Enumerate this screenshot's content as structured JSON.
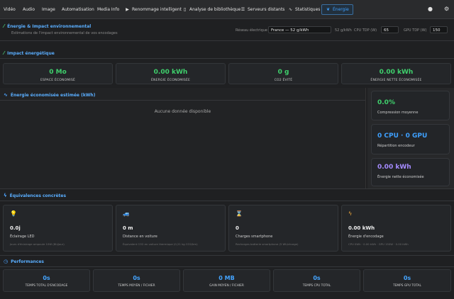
{
  "nav": {
    "items": [
      "Vidéo",
      "Audio",
      "Image",
      "Automatisation",
      "Media Info"
    ],
    "icon_items": [
      {
        "label": "Renommage intelligent",
        "icon": "play-square-icon"
      },
      {
        "label": "Analyse de bibliothèque",
        "icon": "book-icon"
      },
      {
        "label": "Serveurs distants",
        "icon": "server-icon"
      },
      {
        "label": "Statistiques",
        "icon": "chart-line-icon"
      },
      {
        "label": "Énergie",
        "icon": "leaf-icon"
      }
    ],
    "active": "Énergie",
    "right_icons": [
      "user-icon",
      "gear-icon"
    ]
  },
  "header": {
    "title": "Énergie & Impact environnemental",
    "subtitle": "Estimations de l'impact environnemental de vos encodages",
    "grid_label": "Réseau électrique",
    "grid_value": "France — 52 g/kWh",
    "grid_unit": "52 g/kWh",
    "cpu_tdp_label": "CPU TDP (W)",
    "cpu_tdp_value": "65",
    "gpu_tdp_label": "GPU TDP (W)",
    "gpu_tdp_value": "150"
  },
  "impact": {
    "title": "Impact énergétique",
    "stats": [
      {
        "value": "0 Mo",
        "label": "ESPACE ÉCONOMISÉ"
      },
      {
        "value": "0.00 kWh",
        "label": "ÉNERGIE ÉCONOMISÉE"
      },
      {
        "value": "0 g",
        "label": "CO2 ÉVITÉ"
      },
      {
        "value": "0.00 kWh",
        "label": "ÉNERGIE NETTE ÉCONOMISÉE"
      }
    ]
  },
  "chart": {
    "title": "Énergie économisée estimée (kWh)",
    "empty": "Aucune donnée disponible"
  },
  "side": [
    {
      "value": "0.0%",
      "label": "Compression moyenne",
      "color": "#3fd06c"
    },
    {
      "value": "0 CPU · 0 GPU",
      "label": "Répartition encodeur",
      "color": "#3ea0ff"
    },
    {
      "value": "0.00 kWh",
      "label": "Énergie nette économisée",
      "color": "#a58bff"
    }
  ],
  "equivalences": {
    "title": "Équivalences concrètes",
    "cards": [
      {
        "icon": "lightbulb-icon",
        "value": "0.0j",
        "label": "Éclairage LED",
        "desc": "Jours d'éclairage ampoule 10W (8h/jour)"
      },
      {
        "icon": "car-icon",
        "value": "0 m",
        "label": "Distance en voiture",
        "desc": "Équivalent CO2 en voiture thermique (0,21 kg CO2/km)"
      },
      {
        "icon": "hourglass-icon",
        "value": "0",
        "label": "Charges smartphone",
        "desc": "Recharges batterie smartphone (5 Wh/charge)"
      },
      {
        "icon": "bolt-icon",
        "value": "0.00 kWh",
        "label": "Énergie d'encodage",
        "desc": "CPU 0Wh · 0.00 kWh · GPU 150W · 0.00 kWh"
      }
    ]
  },
  "performance": {
    "title": "Performances",
    "cards": [
      {
        "value": "0s",
        "label": "TEMPS TOTAL D'ENCODAGE"
      },
      {
        "value": "0s",
        "label": "TEMPS MOYEN / FICHIER"
      },
      {
        "value": "0 MB",
        "label": "GAIN MOYEN / FICHIER"
      },
      {
        "value": "0s",
        "label": "TEMPS CPU TOTAL"
      },
      {
        "value": "0s",
        "label": "TEMPS GPU TOTAL"
      }
    ]
  }
}
